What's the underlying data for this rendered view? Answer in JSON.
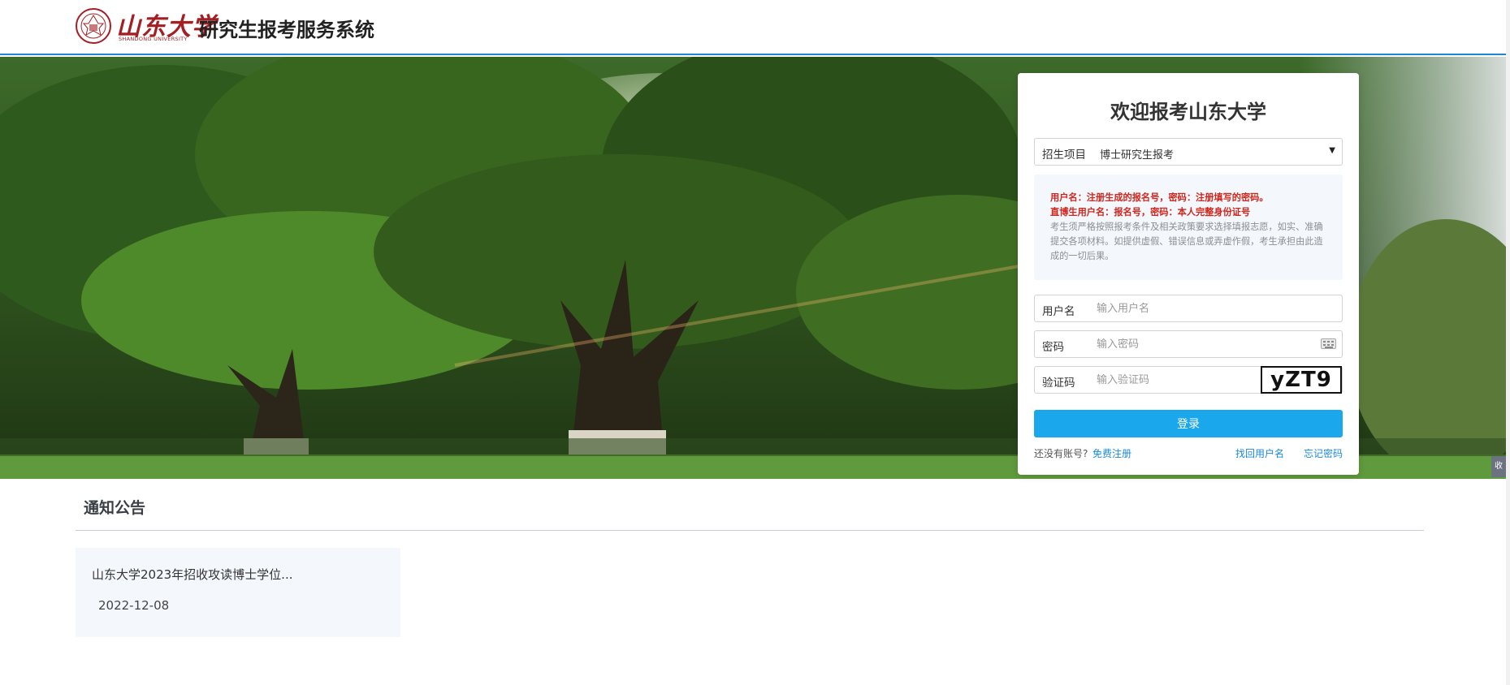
{
  "header": {
    "logo_script": "山东大学",
    "logo_en": "SHANDONG UNIVERSITY",
    "site_title": "研究生报考服务系统"
  },
  "login": {
    "title": "欢迎报考山东大学",
    "project_label": "招生项目",
    "project_value": "博士研究生报考",
    "notice": {
      "line1": "用户名：注册生成的报名号，密码：注册填写的密码。",
      "line2": "直博生用户名：报名号，密码：本人完整身份证号",
      "line3": "考生须严格按照报考条件及相关政策要求选择填报志愿，如实、准确提交各项材料。如提供虚假、错误信息或弄虚作假，考生承担由此造成的一切后果。"
    },
    "username_label": "用户名",
    "username_placeholder": "输入用户名",
    "password_label": "密码",
    "password_placeholder": "输入密码",
    "captcha_label": "验证码",
    "captcha_placeholder": "输入验证码",
    "captcha_text": "yZT9",
    "login_button": "登录",
    "no_account": "还没有账号?",
    "register_link": "免费注册",
    "find_username_link": "找回用户名",
    "forgot_password_link": "忘记密码"
  },
  "side_tab": "收",
  "notices": {
    "title": "通知公告",
    "items": [
      {
        "title": "山东大学2023年招收攻读博士学位...",
        "date": "2022-12-08"
      }
    ]
  },
  "colors": {
    "accent_blue": "#1aa7ec",
    "header_line": "#1f86d6",
    "warning_red": "#d0261d",
    "brand_red": "#a31f24"
  }
}
